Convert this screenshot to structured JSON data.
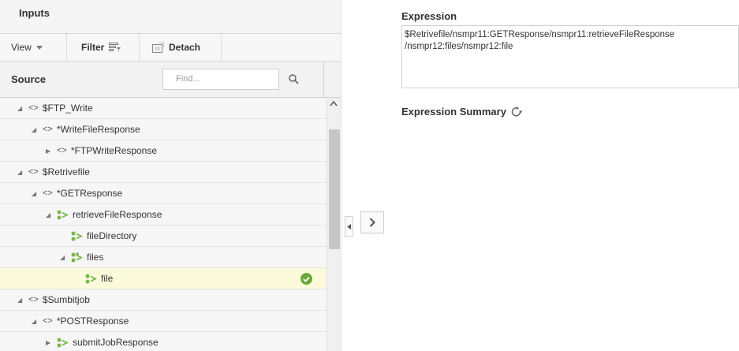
{
  "inputs": {
    "title": "Inputs",
    "toolbar": {
      "view_label": "View",
      "filter_label": "Filter",
      "detach_label": "Detach"
    },
    "source": {
      "label": "Source",
      "find_placeholder": "Find..."
    },
    "tree": [
      {
        "label": "$FTP_Write",
        "indent": 0,
        "expander": "expanded",
        "icon": "element-icon"
      },
      {
        "label": "*WriteFileResponse",
        "indent": 1,
        "expander": "expanded",
        "icon": "element-icon"
      },
      {
        "label": "*FTPWriteResponse",
        "indent": 2,
        "expander": "collapsed",
        "icon": "element-icon"
      },
      {
        "label": "$Retrivefile",
        "indent": 0,
        "expander": "expanded",
        "icon": "element-icon"
      },
      {
        "label": "*GETResponse",
        "indent": 1,
        "expander": "expanded",
        "icon": "element-icon"
      },
      {
        "label": "retrieveFileResponse",
        "indent": 2,
        "expander": "expanded",
        "icon": "complex-type-icon"
      },
      {
        "label": "fileDirectory",
        "indent": 3,
        "expander": "none",
        "icon": "complex-type-icon"
      },
      {
        "label": "files",
        "indent": 3,
        "expander": "expanded",
        "icon": "repeating-element-icon"
      },
      {
        "label": "file",
        "indent": 4,
        "expander": "none",
        "icon": "complex-type-icon",
        "selected": true,
        "check": true
      },
      {
        "label": "$Sumbitjob",
        "indent": 0,
        "expander": "expanded",
        "icon": "element-icon"
      },
      {
        "label": "*POSTResponse",
        "indent": 1,
        "expander": "expanded",
        "icon": "element-icon"
      },
      {
        "label": "submitJobResponse",
        "indent": 2,
        "expander": "collapsed",
        "icon": "complex-type-icon"
      }
    ]
  },
  "expression": {
    "title": "Expression",
    "value": "$Retrivefile/nsmpr11:GETResponse/nsmpr11:retrieveFileResponse\n/nsmpr12:files/nsmpr12:file"
  },
  "summary": {
    "title": "Expression Summary"
  },
  "colors": {
    "selected_row": "#fbfbdc",
    "check_green": "#6aa83a",
    "node_green": "#7ab648"
  }
}
